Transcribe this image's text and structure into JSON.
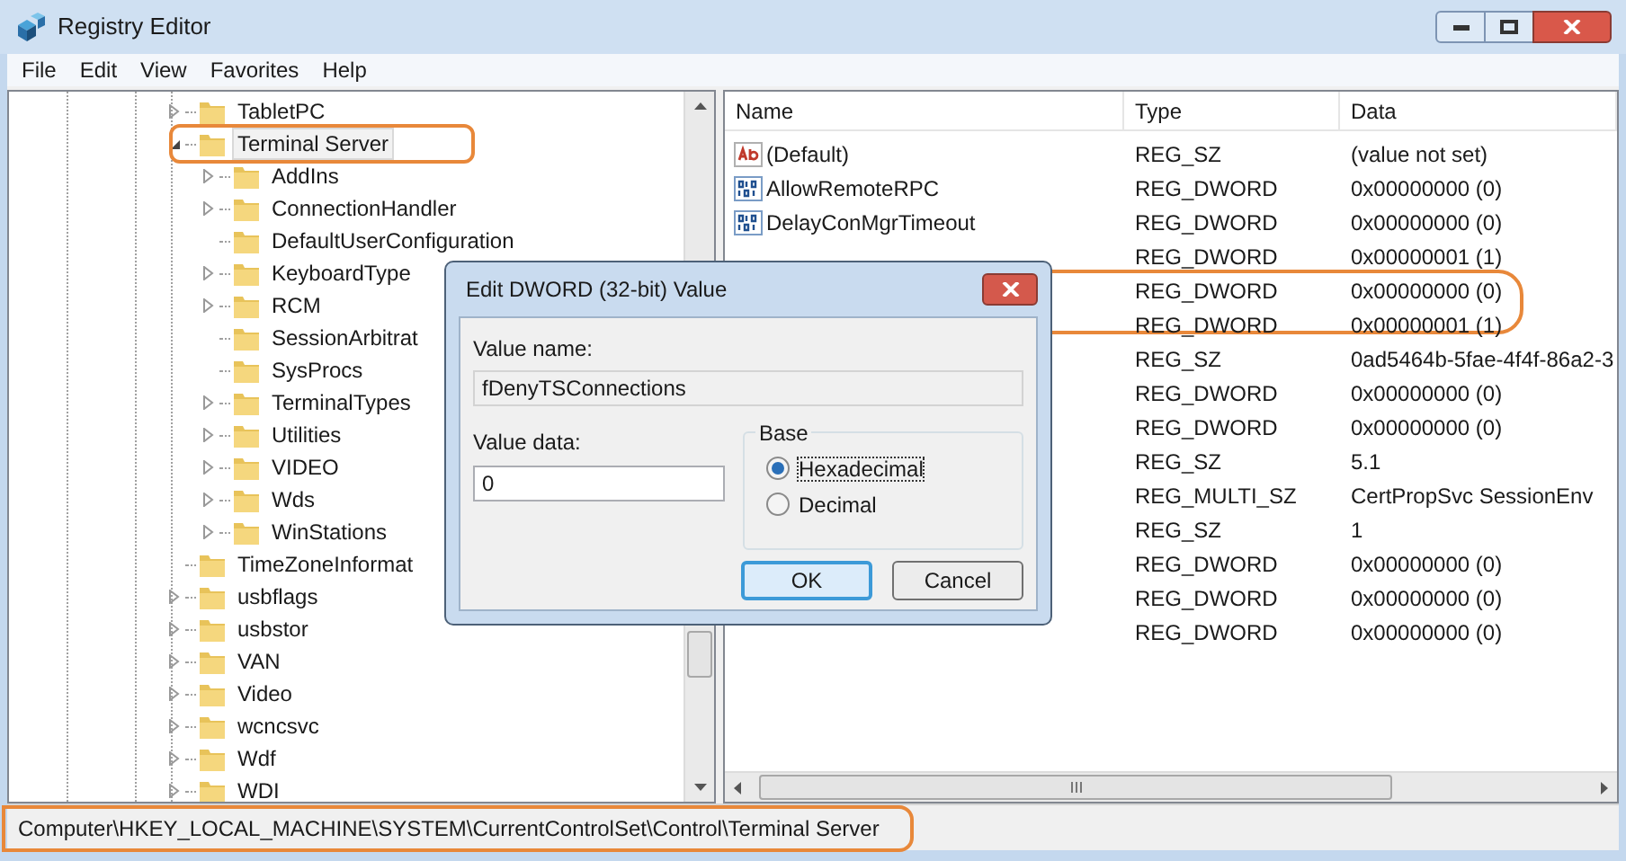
{
  "window": {
    "title": "Registry Editor"
  },
  "menu": [
    "File",
    "Edit",
    "View",
    "Favorites",
    "Help"
  ],
  "tree": [
    {
      "label": "TabletPC",
      "kind": "node",
      "expanded": false,
      "selected": false,
      "highlighted": false
    },
    {
      "label": "Terminal Server",
      "kind": "node",
      "expanded": true,
      "selected": true,
      "highlighted": true,
      "children": [
        {
          "label": "AddIns",
          "kind": "node",
          "expanded": false,
          "selected": false,
          "highlighted": false
        },
        {
          "label": "ConnectionHandler",
          "kind": "node",
          "expanded": false,
          "selected": false,
          "highlighted": false
        },
        {
          "label": "DefaultUserConfiguration",
          "kind": "leaf",
          "selected": false,
          "highlighted": false
        },
        {
          "label": "KeyboardType",
          "kind": "node",
          "expanded": false,
          "selected": false,
          "highlighted": false
        },
        {
          "label": "RCM",
          "kind": "node",
          "expanded": false,
          "selected": false,
          "highlighted": false
        },
        {
          "label": "SessionArbitrat",
          "kind": "leaf",
          "selected": false,
          "highlighted": false
        },
        {
          "label": "SysProcs",
          "kind": "leaf",
          "selected": false,
          "highlighted": false
        },
        {
          "label": "TerminalTypes",
          "kind": "node",
          "expanded": false,
          "selected": false,
          "highlighted": false
        },
        {
          "label": "Utilities",
          "kind": "node",
          "expanded": false,
          "selected": false,
          "highlighted": false
        },
        {
          "label": "VIDEO",
          "kind": "node",
          "expanded": false,
          "selected": false,
          "highlighted": false
        },
        {
          "label": "Wds",
          "kind": "node",
          "expanded": false,
          "selected": false,
          "highlighted": false
        },
        {
          "label": "WinStations",
          "kind": "node",
          "expanded": false,
          "selected": false,
          "highlighted": false
        }
      ]
    },
    {
      "label": "TimeZoneInformat",
      "kind": "leaf",
      "selected": false,
      "highlighted": false
    },
    {
      "label": "usbflags",
      "kind": "node",
      "expanded": false,
      "selected": false,
      "highlighted": false
    },
    {
      "label": "usbstor",
      "kind": "node",
      "expanded": false,
      "selected": false,
      "highlighted": false
    },
    {
      "label": "VAN",
      "kind": "node",
      "expanded": false,
      "selected": false,
      "highlighted": false
    },
    {
      "label": "Video",
      "kind": "node",
      "expanded": false,
      "selected": false,
      "highlighted": false
    },
    {
      "label": "wcncsvc",
      "kind": "node",
      "expanded": false,
      "selected": false,
      "highlighted": false
    },
    {
      "label": "Wdf",
      "kind": "node",
      "expanded": false,
      "selected": false,
      "highlighted": false
    },
    {
      "label": "WDI",
      "kind": "node",
      "expanded": false,
      "selected": false,
      "highlighted": false
    }
  ],
  "values": {
    "columns": [
      "Name",
      "Type",
      "Data"
    ],
    "rows": [
      {
        "kind": "string",
        "name": "(Default)",
        "type": "REG_SZ",
        "data": "(value not set)",
        "highlighted": false
      },
      {
        "kind": "dword",
        "name": "AllowRemoteRPC",
        "type": "REG_DWORD",
        "data": "0x00000000 (0)",
        "highlighted": false
      },
      {
        "kind": "dword",
        "name": "DelayConMgrTimeout",
        "type": "REG_DWORD",
        "data": "0x00000000 (0)",
        "highlighted": false
      },
      {
        "type": "REG_DWORD",
        "data": "0x00000001 (1)",
        "highlighted": false
      },
      {
        "type": "REG_DWORD",
        "data": "0x00000000 (0)",
        "highlighted": true
      },
      {
        "type": "REG_DWORD",
        "data": "0x00000001 (1)",
        "highlighted": false
      },
      {
        "type": "REG_SZ",
        "data": "0ad5464b-5fae-4f4f-86a2-3",
        "highlighted": false
      },
      {
        "type": "REG_DWORD",
        "data": "0x00000000 (0)",
        "highlighted": false
      },
      {
        "type": "REG_DWORD",
        "data": "0x00000000 (0)",
        "highlighted": false
      },
      {
        "type": "REG_SZ",
        "data": "5.1",
        "highlighted": false
      },
      {
        "type": "REG_MULTI_SZ",
        "data": "CertPropSvc SessionEnv",
        "highlighted": false
      },
      {
        "type": "REG_SZ",
        "data": "1",
        "highlighted": false
      },
      {
        "type": "REG_DWORD",
        "data": "0x00000000 (0)",
        "highlighted": false
      },
      {
        "type": "REG_DWORD",
        "data": "0x00000000 (0)",
        "highlighted": false
      },
      {
        "type": "REG_DWORD",
        "data": "0x00000000 (0)",
        "highlighted": false
      }
    ]
  },
  "dialog": {
    "title": "Edit DWORD (32-bit) Value",
    "value_name_label": "Value name:",
    "value_name": "fDenyTSConnections",
    "value_data_label": "Value data:",
    "value_data": "0",
    "base_label": "Base",
    "bases": [
      {
        "label": "Hexadecimal",
        "selected": true
      },
      {
        "label": "Decimal",
        "selected": false
      }
    ],
    "buttons": [
      {
        "label": "OK",
        "default": true
      },
      {
        "label": "Cancel",
        "default": false
      }
    ]
  },
  "status_bar": {
    "path": "Computer\\HKEY_LOCAL_MACHINE\\SYSTEM\\CurrentControlSet\\Control\\Terminal Server",
    "highlighted": true
  }
}
